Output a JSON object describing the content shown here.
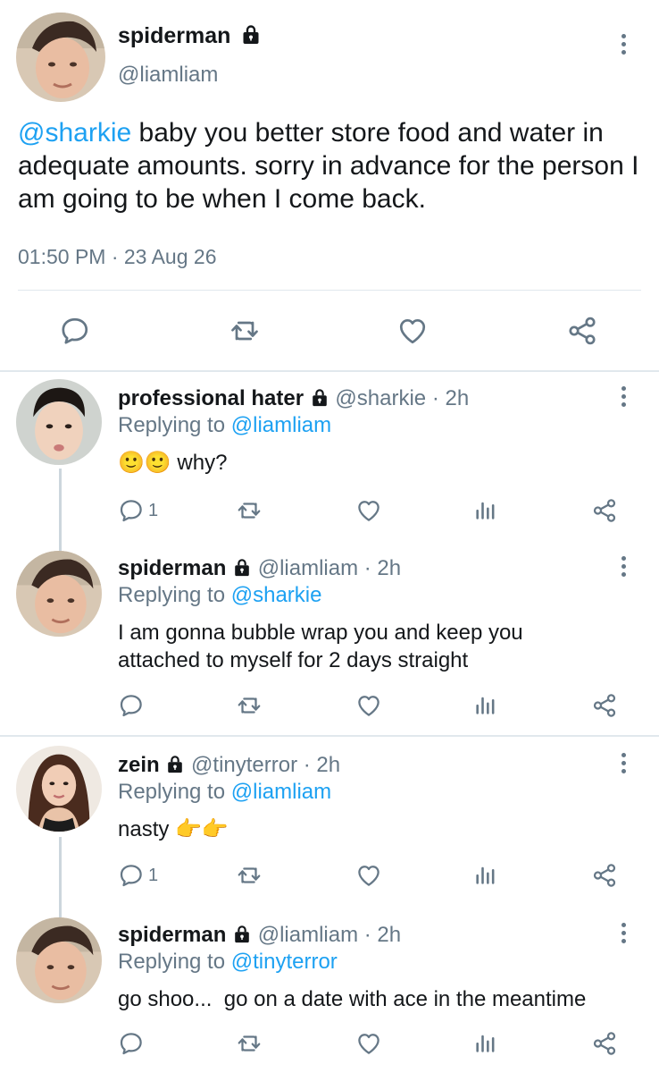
{
  "main_tweet": {
    "name": "spiderman",
    "handle": "@liamliam",
    "mention": "@sharkie",
    "text_rest": " baby you better store food and water in adequate amounts. sorry in advance for the person I am going to be when I come back.",
    "timestamp": "01:50 PM · 23 Aug 26"
  },
  "replies": [
    {
      "name": "professional hater",
      "handle": "@sharkie",
      "time": "· 2h",
      "replying_prefix": "Replying to ",
      "replying_to": "@liamliam",
      "text": " why?",
      "emoji": "🙂🙂",
      "reply_count": "1"
    },
    {
      "name": "spiderman",
      "handle": "@liamliam",
      "time": "· 2h",
      "replying_prefix": "Replying to ",
      "replying_to": "@sharkie",
      "text": "I am gonna bubble wrap you and keep you attached to myself for 2 days straight",
      "reply_count": ""
    },
    {
      "name": "zein",
      "handle": "@tinyterror",
      "time": "· 2h",
      "replying_prefix": "Replying to ",
      "replying_to": "@liamliam",
      "text": "nasty ",
      "emoji": "👉👉",
      "reply_count": "1"
    },
    {
      "name": "spiderman",
      "handle": "@liamliam",
      "time": "· 2h",
      "replying_prefix": "Replying to ",
      "replying_to": "@tinyterror",
      "text": "go shoo...  go on a date with ace in the meantime",
      "reply_count": ""
    }
  ],
  "icons": {
    "reply": "reply-icon",
    "retweet": "retweet-icon",
    "like": "heart-icon",
    "share": "share-icon",
    "analytics": "analytics-icon",
    "more": "more-icon",
    "lock": "lock-icon"
  },
  "colors": {
    "link": "#1da1f2",
    "muted": "#657786",
    "text": "#14171a",
    "divider": "#e1e8ed"
  }
}
